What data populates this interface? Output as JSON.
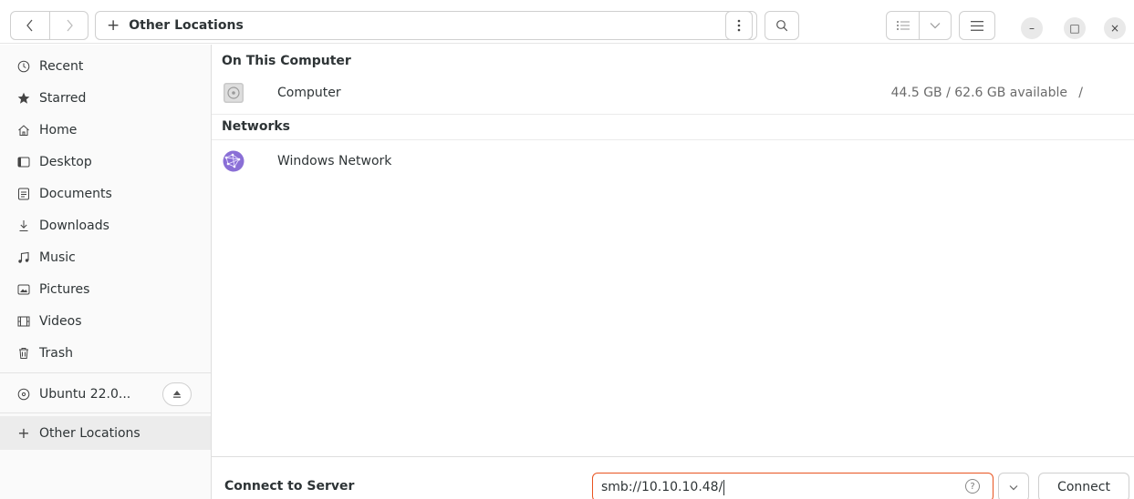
{
  "header": {
    "back_icon": "chevron-left-icon",
    "forward_icon": "chevron-right-icon",
    "path_label": "Other Locations",
    "menu_icon": "vertical-dots-icon",
    "search_icon": "search-icon",
    "view_icon": "list-view-icon",
    "view_dropdown_icon": "chevron-down-icon",
    "hamburger_icon": "hamburger-menu-icon"
  },
  "window_controls": {
    "minimize": "–",
    "maximize": "□",
    "close": "×"
  },
  "sidebar": {
    "items": [
      {
        "label": "Recent",
        "icon": "clock-icon"
      },
      {
        "label": "Starred",
        "icon": "star-icon"
      },
      {
        "label": "Home",
        "icon": "home-icon"
      },
      {
        "label": "Desktop",
        "icon": "desktop-icon"
      },
      {
        "label": "Documents",
        "icon": "document-icon"
      },
      {
        "label": "Downloads",
        "icon": "download-icon"
      },
      {
        "label": "Music",
        "icon": "music-icon"
      },
      {
        "label": "Pictures",
        "icon": "picture-icon"
      },
      {
        "label": "Videos",
        "icon": "video-icon"
      },
      {
        "label": "Trash",
        "icon": "trash-icon"
      }
    ],
    "device": {
      "label": "Ubuntu 22.0...",
      "icon": "disc-icon",
      "eject_icon": "eject-icon"
    },
    "other_locations": {
      "label": "Other Locations",
      "icon": "plus-icon"
    }
  },
  "main": {
    "section_computer": "On This Computer",
    "computer": {
      "name": "Computer",
      "info": "44.5 GB / 62.6 GB available",
      "path": "/"
    },
    "section_networks": "Networks",
    "network": {
      "name": "Windows Network"
    }
  },
  "connect_bar": {
    "label": "Connect to Server",
    "address_value": "smb://10.10.10.48/",
    "help_icon": "help-icon",
    "recent_servers_icon": "chevron-down-icon",
    "connect_label": "Connect"
  },
  "colors": {
    "accent": "#e95420",
    "network_icon": "#8a6fd6"
  }
}
